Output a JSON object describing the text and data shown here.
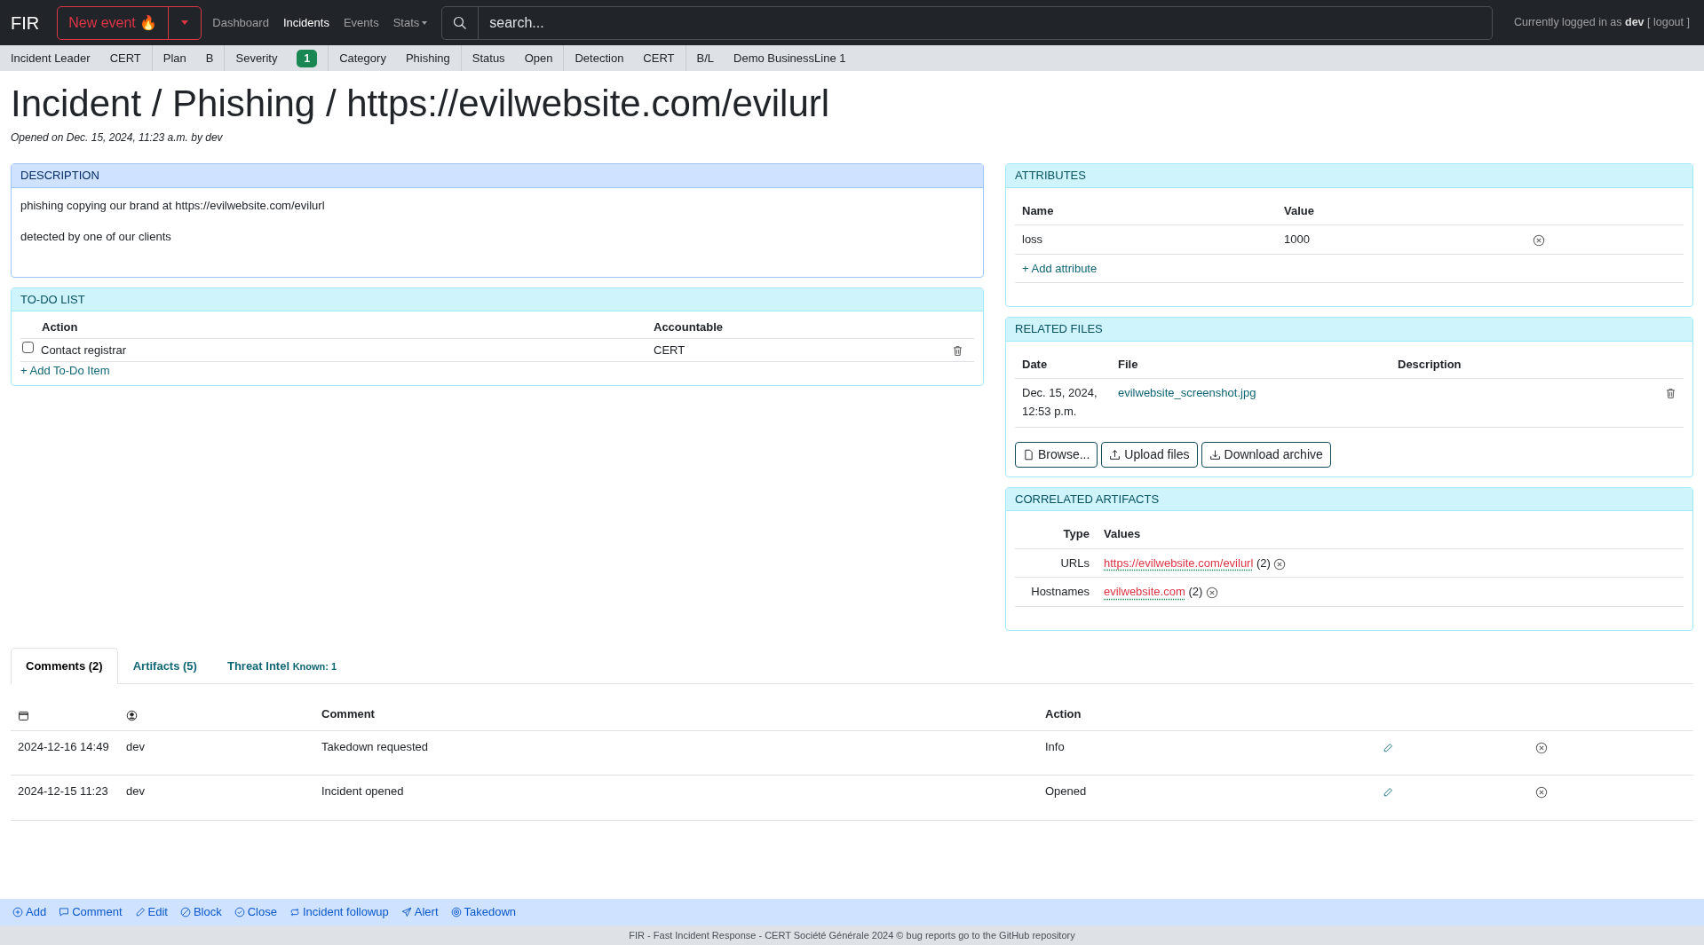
{
  "navbar": {
    "brand": "FIR",
    "new_event": "New event 🔥",
    "links": [
      {
        "label": "Dashboard",
        "selected": false,
        "dropdown": false
      },
      {
        "label": "Incidents",
        "selected": true,
        "dropdown": false
      },
      {
        "label": "Events",
        "selected": false,
        "dropdown": false
      },
      {
        "label": "Stats",
        "selected": false,
        "dropdown": true
      }
    ],
    "search": {
      "placeholder": "search..."
    },
    "user_text": "Currently logged in as **dev** [ logout ]"
  },
  "info_bar": [
    {
      "label": "Incident Leader",
      "value": "CERT",
      "kind": "text"
    },
    {
      "label": "Plan",
      "value": "B",
      "kind": "text"
    },
    {
      "label": "Severity",
      "value": "1",
      "kind": "badge"
    },
    {
      "label": "Category",
      "value": "Phishing",
      "kind": "text"
    },
    {
      "label": "Status",
      "value": "Open",
      "kind": "text"
    },
    {
      "label": "Detection",
      "value": "CERT",
      "kind": "text"
    },
    {
      "label": "B/L",
      "value": "Demo BusinessLine 1",
      "kind": "text"
    }
  ],
  "title": "Incident / Phishing / https://evilwebsite.com/evilurl",
  "opened": "Opened on Dec. 15, 2024, 11:23 a.m. by dev",
  "description": {
    "header": "DESCRIPTION",
    "paragraphs": [
      "phishing copying our brand at https://evilwebsite.com/evilurl",
      "detected by one of our clients"
    ]
  },
  "todo": {
    "header": "TO-DO LIST",
    "columns": [
      "Action",
      "Accountable"
    ],
    "items": [
      {
        "action": "Contact registrar",
        "accountable": "CERT",
        "checked": false
      }
    ],
    "add_link": "+ Add To-Do Item"
  },
  "attributes": {
    "header": "ATTRIBUTES",
    "columns": [
      "Name",
      "Value"
    ],
    "rows": [
      {
        "name": "loss",
        "value": "1000"
      }
    ],
    "add_link": "+ Add attribute"
  },
  "related_files": {
    "header": "RELATED FILES",
    "columns": [
      "Date",
      "File",
      "Description"
    ],
    "rows": [
      {
        "date": "Dec. 15, 2024, 12:53 p.m.",
        "file": "evilwebsite_screenshot.jpg"
      }
    ],
    "buttons": [
      "Browse...",
      "Upload files",
      "Download archive"
    ]
  },
  "correlated_artifacts": {
    "header": "CORRELATED ARTIFACTS",
    "columns": [
      "Type",
      "Values"
    ],
    "rows": [
      {
        "type": "URLs",
        "value": "https://evilwebsite.com/evilurl",
        "count": "(2)"
      },
      {
        "type": "Hostnames",
        "value": "evilwebsite.com",
        "count": "(2)"
      }
    ]
  },
  "tabs": [
    {
      "label": "Comments (2)",
      "selected": true
    },
    {
      "label": "Artifacts (5)",
      "selected": false
    },
    {
      "label": "Threat Intel",
      "note": "Known: 1",
      "selected": false
    }
  ],
  "comments": {
    "columns": [
      "Comment",
      "Action"
    ],
    "rows": [
      {
        "date": "2024-12-16 14:49",
        "user": "dev",
        "comment": "Takedown requested",
        "action": "Info"
      },
      {
        "date": "2024-12-15 11:23",
        "user": "dev",
        "comment": "Incident opened",
        "action": "Opened"
      }
    ]
  },
  "actions": [
    "Add",
    "Comment",
    "Edit",
    "Block",
    "Close",
    "Incident followup",
    "Alert",
    "Takedown"
  ],
  "footer": {
    "before": "FIR - Fast Incident Response - ",
    "link1": "CERT Société Générale 2024",
    "middle": " © bug reports go to ",
    "link2": "the GitHub repository"
  }
}
